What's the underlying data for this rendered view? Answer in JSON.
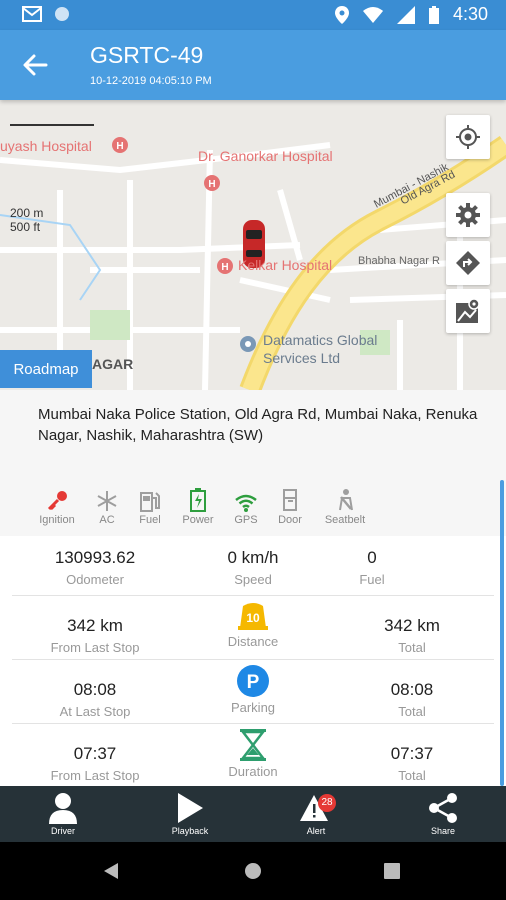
{
  "status_bar": {
    "time": "4:30"
  },
  "app_bar": {
    "title": "GSRTC-49",
    "subtitle": "10-12-2019 04:05:10 PM"
  },
  "map": {
    "scale_m": "200 m",
    "scale_ft": "500 ft",
    "labels": {
      "hospital1": "uyash Hospital",
      "hospital2": "Dr. Ganorkar Hospital",
      "hospital3": "Kelkar Hospital",
      "road1": "Mumbai - Nashik",
      "road2": "Old Agra Rd",
      "road3": "Bhabha Nagar R",
      "poi1_line1": "Datamatics Global",
      "poi1_line2": "Services Ltd",
      "area": "AGAR"
    },
    "roadmap_label": "Roadmap"
  },
  "address": "Mumbai Naka Police Station, Old Agra Rd, Mumbai Naka, Renuka Nagar, Nashik, Maharashtra (SW)",
  "status_icons": [
    {
      "label": "Ignition",
      "icon": "key-icon",
      "color": "#e53935"
    },
    {
      "label": "AC",
      "icon": "snowflake-icon",
      "color": "#9e9e9e"
    },
    {
      "label": "Fuel",
      "icon": "fuel-pump-icon",
      "color": "#9e9e9e"
    },
    {
      "label": "Power",
      "icon": "battery-icon",
      "color": "#2e9e3e"
    },
    {
      "label": "GPS",
      "icon": "wifi-icon",
      "color": "#2e9e3e"
    },
    {
      "label": "Door",
      "icon": "door-icon",
      "color": "#9e9e9e"
    },
    {
      "label": "Seatbelt",
      "icon": "seatbelt-icon",
      "color": "#9e9e9e"
    }
  ],
  "metrics": {
    "row1": {
      "left_value": "130993.62",
      "left_label": "Odometer",
      "mid_value": "0 km/h",
      "mid_label": "Speed",
      "right_value": "0",
      "right_label": "Fuel"
    },
    "row2": {
      "left_value": "342 km",
      "left_label": "From Last Stop",
      "mid_badge": "10",
      "mid_label": "Distance",
      "right_value": "342 km",
      "right_label": "Total"
    },
    "row3": {
      "left_value": "08:08",
      "left_label": "At Last Stop",
      "mid_badge": "P",
      "mid_label": "Parking",
      "right_value": "08:08",
      "right_label": "Total"
    },
    "row4": {
      "left_value": "07:37",
      "left_label": "From Last Stop",
      "mid_label": "Duration",
      "right_value": "07:37",
      "right_label": "Total"
    }
  },
  "bottom_bar": {
    "driver": "Driver",
    "playback": "Playback",
    "alert": "Alert",
    "alert_badge": "28",
    "share": "Share"
  }
}
